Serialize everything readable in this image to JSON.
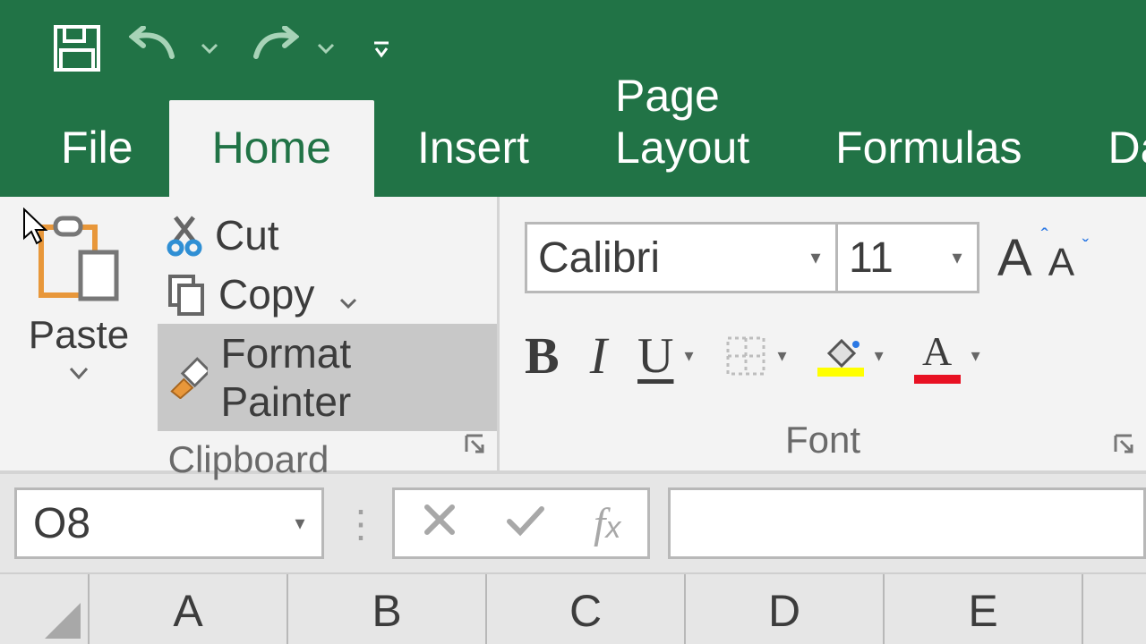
{
  "tabs": {
    "file": "File",
    "home": "Home",
    "insert": "Insert",
    "page_layout": "Page Layout",
    "formulas": "Formulas",
    "data": "Data"
  },
  "clipboard": {
    "paste_label": "Paste",
    "cut_label": "Cut",
    "copy_label": "Copy",
    "format_painter_label": "Format Painter",
    "group_label": "Clipboard"
  },
  "font": {
    "name": "Calibri",
    "size": "11",
    "group_label": "Font",
    "fill_color": "#ffff00",
    "font_color": "#e81123",
    "grow_up_color": "#2b78e4",
    "shrink_down_color": "#2b78e4"
  },
  "namebar": {
    "cell_ref": "O8"
  },
  "columns": [
    "A",
    "B",
    "C",
    "D",
    "E"
  ],
  "colors": {
    "brand_green": "#217346"
  }
}
